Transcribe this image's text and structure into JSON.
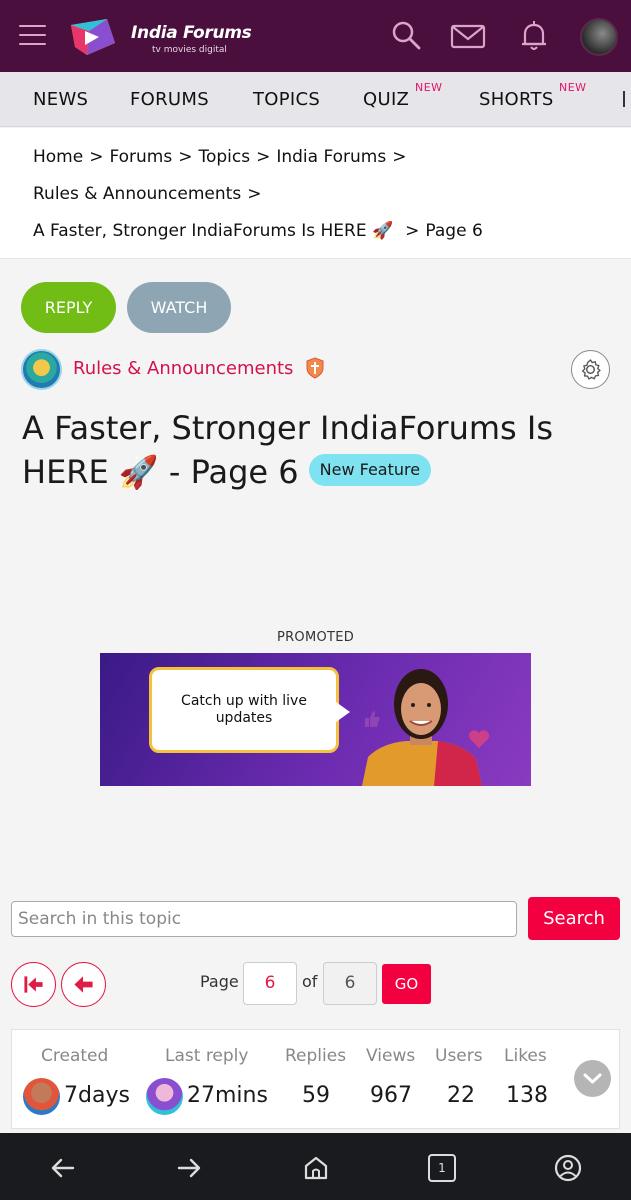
{
  "header": {
    "logo_title": "India Forums",
    "logo_subtitle": "tv  movies  digital"
  },
  "nav": {
    "items": [
      {
        "label": "NEWS",
        "new": ""
      },
      {
        "label": "FORUMS",
        "new": ""
      },
      {
        "label": "TOPICS",
        "new": ""
      },
      {
        "label": "QUIZ",
        "new": "NEW"
      },
      {
        "label": "SHORTS",
        "new": "NEW"
      }
    ]
  },
  "breadcrumb": {
    "home": "Home",
    "forums": "Forums",
    "topics": "Topics",
    "india_forums": "India Forums",
    "rules": "Rules & Announcements",
    "topic": "A Faster, Stronger IndiaForums Is HERE 🚀",
    "page": "Page 6",
    "separator": ">"
  },
  "actions": {
    "reply": "REPLY",
    "watch": "WATCH"
  },
  "forum": {
    "name": "Rules & Announcements"
  },
  "topic": {
    "title": "A Faster, Stronger IndiaForums Is HERE 🚀 - Page 6",
    "badge": "New Feature"
  },
  "promo": {
    "label": "PROMOTED",
    "text": "Catch up with live updates"
  },
  "search": {
    "placeholder": "Search in this topic",
    "button": "Search"
  },
  "pagination": {
    "page_label": "Page",
    "current": "6",
    "of_label": "of",
    "total": "6",
    "go": "GO"
  },
  "stats": {
    "created_label": "Created",
    "created_value": "7days",
    "last_reply_label": "Last reply",
    "last_reply_value": "27mins",
    "replies_label": "Replies",
    "replies_value": "59",
    "views_label": "Views",
    "views_value": "967",
    "users_label": "Users",
    "users_value": "22",
    "likes_label": "Likes",
    "likes_value": "138"
  },
  "bottom_nav": {
    "tab_count": "1"
  },
  "colors": {
    "header_bg": "#4a0f3d",
    "accent_red": "#f2003f",
    "reply_green": "#71bd16",
    "forum_name": "#d5114b"
  }
}
